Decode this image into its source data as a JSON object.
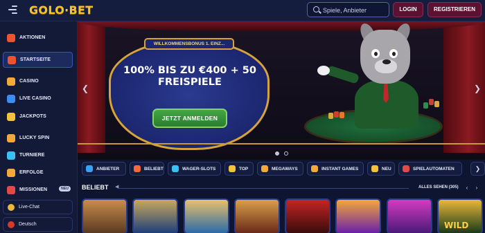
{
  "header": {
    "logo": "GOLO·BET",
    "search_placeholder": "Spiele, Anbieter",
    "login_label": "LOGIN",
    "register_label": "REGISTRIEREN"
  },
  "sidebar": {
    "items": [
      {
        "label": "AKTIONEN",
        "icon": "gift-icon",
        "color": "#e8552f"
      },
      {
        "label": "STARTSEITE",
        "icon": "home-icon",
        "color": "#e8552f"
      },
      {
        "label": "CASINO",
        "icon": "casino-icon",
        "color": "#f2a83a"
      },
      {
        "label": "LIVE CASINO",
        "icon": "live-casino-icon",
        "color": "#3a8ef2"
      },
      {
        "label": "JACKPOTS",
        "icon": "jackpot-icon",
        "color": "#f2c23a"
      },
      {
        "label": "LUCKY SPIN",
        "icon": "lucky-spin-icon",
        "color": "#f2a83a"
      },
      {
        "label": "TURNIERE",
        "icon": "trophy-icon",
        "color": "#3ac0f2"
      },
      {
        "label": "ERFOLGE",
        "icon": "medal-icon",
        "color": "#f2a83a"
      },
      {
        "label": "MISSIONEN",
        "icon": "missions-icon",
        "color": "#e24a4a",
        "badge": "NEU"
      }
    ],
    "live_chat": "Live-Chat",
    "language": "Deutsch"
  },
  "hero": {
    "tab_label": "WILLKOMMENSBONUS 1. EINZ...",
    "title_line1": "100% BIS ZU €400 + 50",
    "title_line2": "FREISPIELE",
    "cta_label": "JETZT ANMELDEN",
    "slide_count": 2,
    "active_slide": 1
  },
  "categories": [
    {
      "label": "ANBIETER",
      "icon": "provider-icon",
      "color": "#3aa0f2"
    },
    {
      "label": "BELIEBT",
      "icon": "fire-icon",
      "color": "#f26a3a"
    },
    {
      "label": "WAGER-SLOTS",
      "icon": "wager-slots-icon",
      "color": "#3ac0f2"
    },
    {
      "label": "TOP",
      "icon": "star-icon",
      "color": "#f2c23a"
    },
    {
      "label": "MEGAWAYS",
      "icon": "megaways-icon",
      "color": "#f2a83a"
    },
    {
      "label": "INSTANT GAMES",
      "icon": "instant-games-icon",
      "color": "#f2a83a"
    },
    {
      "label": "NEU",
      "icon": "lightning-icon",
      "color": "#f2c23a"
    },
    {
      "label": "SPIELAUTOMATEN",
      "icon": "slot-machine-icon",
      "color": "#e24a4a"
    }
  ],
  "section": {
    "title": "BELIEBT",
    "see_all": "ALLES SEHEN (305)"
  },
  "games": [
    {
      "colors": [
        "#5a3a22",
        "#c98d4a"
      ]
    },
    {
      "colors": [
        "#1d3f7a",
        "#c9a85a"
      ]
    },
    {
      "colors": [
        "#2a6aa8",
        "#e8c16a"
      ]
    },
    {
      "colors": [
        "#6a2a1a",
        "#d8a04a"
      ]
    },
    {
      "colors": [
        "#3a0c0c",
        "#c52424"
      ]
    },
    {
      "colors": [
        "#6a1fa8",
        "#f2a83a"
      ]
    },
    {
      "colors": [
        "#4a1a7a",
        "#d43ac0"
      ]
    },
    {
      "colors": [
        "#1a3a1a",
        "#e8b83a"
      ],
      "label": "WILD"
    }
  ]
}
